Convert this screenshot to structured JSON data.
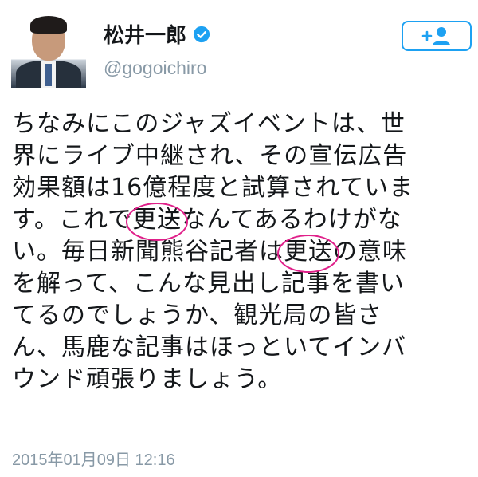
{
  "profile": {
    "name": "松井一郎",
    "handle": "@gogoichiro",
    "verified": true,
    "avatar_icon": "person-photo"
  },
  "follow_button": {
    "icon": "add-user-icon"
  },
  "tweet": {
    "lines": [
      "ちなみにこのジャズイベントは、世",
      "界にライブ中継され、その宣伝広告",
      "効果額は16億程度と試算されていま",
      {
        "before": "す。これで",
        "circled": "更送",
        "after": "なんてあるわけがな"
      },
      {
        "before": "い。毎日新聞熊谷記者は",
        "circled": "更送",
        "after": "の意味"
      },
      "を解って、こんな見出し記事を書い",
      "てるのでしょうか、観光局の皆さ",
      "ん、馬鹿な記事はほっといてインバ",
      "ウンド頑張りましょう。"
    ],
    "highlight_color": "#e0208a"
  },
  "timestamp": "2015年01月09日 12:16",
  "colors": {
    "accent": "#1da1f2",
    "muted": "#8899a6",
    "text": "#14171a"
  }
}
